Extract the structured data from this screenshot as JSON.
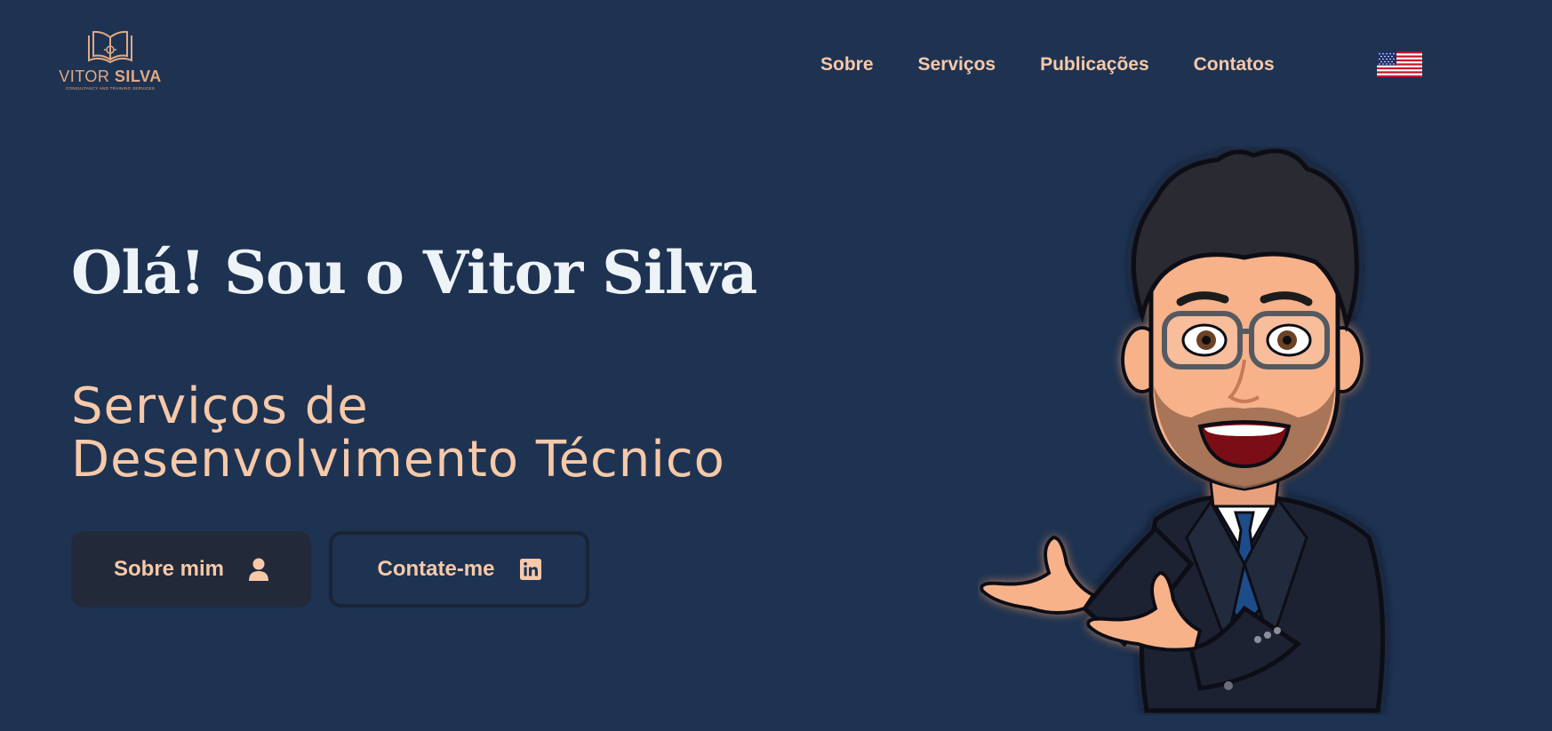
{
  "header": {
    "logo": {
      "name_light": "VITOR ",
      "name_bold": "SILVA",
      "tagline": "CONSULTANCY AND TRAINING SERVICES"
    },
    "nav": [
      {
        "label": "Sobre"
      },
      {
        "label": "Serviços"
      },
      {
        "label": "Publicações"
      },
      {
        "label": "Contatos"
      }
    ],
    "language_icon": "us-flag-icon"
  },
  "hero": {
    "title": "Olá! Sou o Vitor Silva",
    "subtitle_line1": "Serviços de",
    "subtitle_line2": "Desenvolvimento Técnico",
    "buttons": {
      "about": {
        "label": "Sobre mim",
        "icon": "user-icon"
      },
      "contact": {
        "label": "Contate-me",
        "icon": "linkedin-icon"
      }
    },
    "avatar_icon": "cartoon-avatar"
  },
  "colors": {
    "background": "#1e3352",
    "accent": "#f7c9a9",
    "title": "#eef3f8",
    "button_dark": "#222a3a"
  }
}
